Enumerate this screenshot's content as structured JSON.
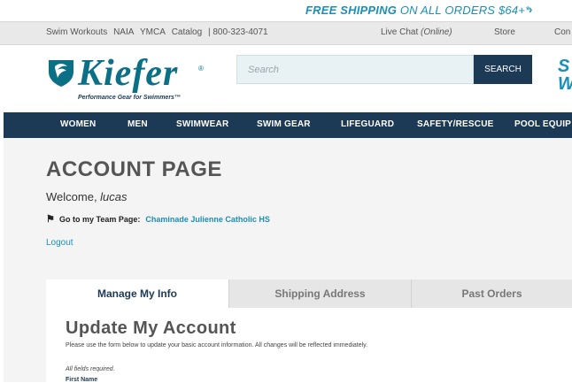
{
  "promo": {
    "text_bold": "FREE SHIPPING",
    "text_rest": " ON ALL ORDERS $64+*",
    "arrow": "›"
  },
  "utility": {
    "links": [
      "Swim Workouts",
      "NAIA",
      "YMCA",
      "Catalog",
      "| 800-323-4071"
    ],
    "live_chat": "Live Chat",
    "live_status": "(Online)",
    "store": "Store",
    "contact": "Con"
  },
  "header": {
    "logo_word": "Kiefer",
    "logo_reg": "®",
    "logo_tagline": "Performance Gear for Swimmers™",
    "search_placeholder": "Search",
    "search_button": "SEARCH",
    "side_promo": "S W"
  },
  "nav": {
    "items": [
      "WOMEN",
      "MEN",
      "SWIMWEAR",
      "SWIM GEAR",
      "LIFEGUARD",
      "SAFETY/RESCUE",
      "POOL EQUIP"
    ]
  },
  "account": {
    "title": "ACCOUNT PAGE",
    "welcome_prefix": "Welcome, ",
    "username": "lucas",
    "team_label": "Go to my Team Page:",
    "team_name": "Chaminade Julienne Catholic HS",
    "logout": "Logout"
  },
  "tabs": [
    "Manage My Info",
    "Shipping Address",
    "Past Orders"
  ],
  "form": {
    "title": "Update My Account",
    "description": "Please use the form below to update your basic account information. All changes will be reflected immediately.",
    "required_note": "All fields required.",
    "first_name_label": "First Name"
  },
  "colors": {
    "brand_teal": "#0b6f86",
    "accent_blue": "#1b8fb5",
    "nav_navy": "#1c3a55"
  }
}
